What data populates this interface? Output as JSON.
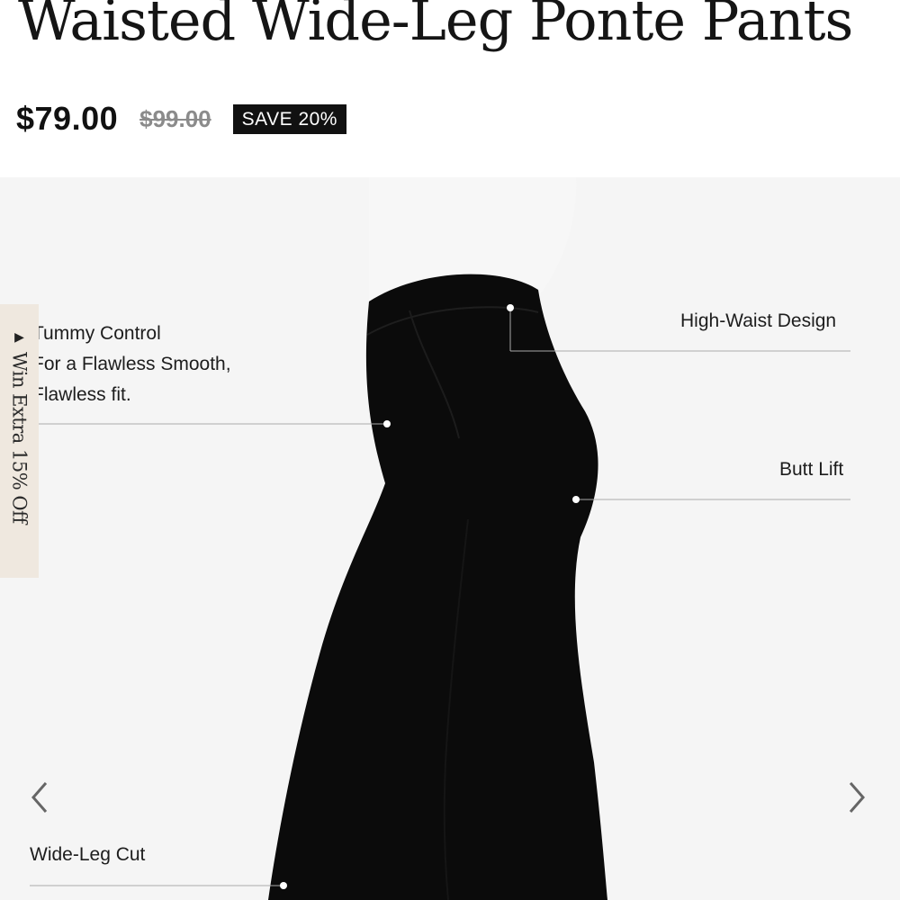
{
  "product": {
    "title": "Waisted Wide-Leg Ponte Pants",
    "price_current": "$79.00",
    "price_original": "$99.00",
    "save_badge": "SAVE 20%"
  },
  "gallery": {
    "callouts": {
      "tummy_line1": "Tummy Control",
      "tummy_line2": "For a Flawless Smooth,",
      "tummy_line3": "Flawless fit.",
      "high_waist": "High-Waist Design",
      "butt_lift": "Butt Lift",
      "wide_leg": "Wide-Leg Cut"
    },
    "prev_icon": "chevron-left-icon",
    "next_icon": "chevron-right-icon"
  },
  "side_tab": {
    "label": "Win Extra 15% Off",
    "icon": "triangle-right-icon"
  },
  "colors": {
    "pants": "#0b0b0b",
    "shirt": "#f7f7f7",
    "gallery_bg": "#f5f5f5",
    "badge_bg": "#111111",
    "side_tab_bg": "#efe8df"
  }
}
